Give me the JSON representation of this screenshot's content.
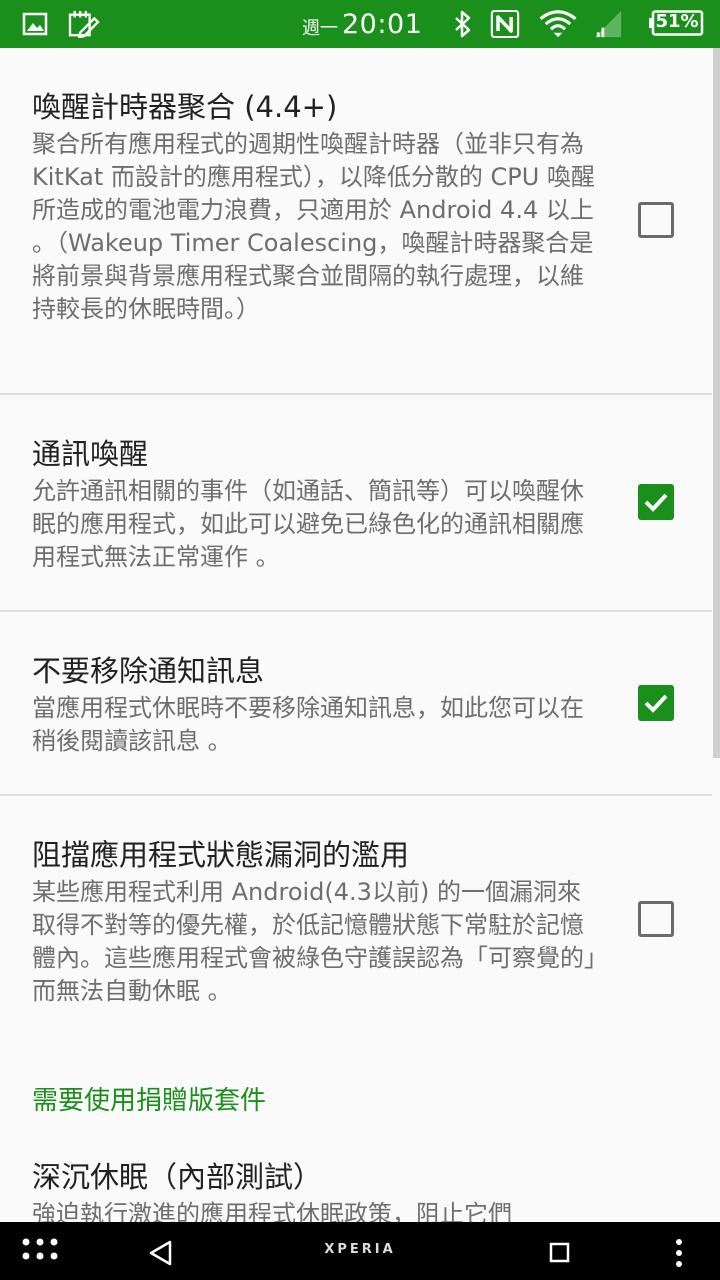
{
  "status_bar": {
    "day_of_week": "週一",
    "time": "20:01",
    "battery": "51%",
    "icons": [
      "image-icon",
      "edit-note-icon",
      "bluetooth-icon",
      "nfc-icon",
      "wifi-icon",
      "signal-icon",
      "battery-icon"
    ]
  },
  "preferences": [
    {
      "title": "喚醒計時器聚合 (4.4+)",
      "summary": "聚合所有應用程式的週期性喚醒計時器（並非只有為 KitKat 而設計的應用程式），以降低分散的 CPU 喚醒所造成的電池電力浪費，只適用於 Android 4.4 以上 。（Wakeup Timer Coalescing，喚醒計時器聚合是將前景與背景應用程式聚合並間隔的執行處理，以維持較長的休眠時間。）",
      "checked": false
    },
    {
      "title": "通訊喚醒",
      "summary": "允許通訊相關的事件（如通話、簡訊等）可以喚醒休眠的應用程式，如此可以避免已綠色化的通訊相關應用程式無法正常運作 。",
      "checked": true
    },
    {
      "title": "不要移除通知訊息",
      "summary": "當應用程式休眠時不要移除通知訊息，如此您可以在稍後閱讀該訊息 。",
      "checked": true
    },
    {
      "title": "阻擋應用程式狀態漏洞的濫用",
      "summary": "某些應用程式利用 Android(4.3以前) 的一個漏洞來取得不對等的優先權，於低記憶體狀態下常駐於記憶體內。這些應用程式會被綠色守護誤認為「可察覺的」而無法自動休眠 。",
      "checked": false
    }
  ],
  "category_header": "需要使用捐贈版套件",
  "deep_hibernation": {
    "title": "深沉休眠（內部測試）",
    "summary": "強迫執行激進的應用程式休眠政策，阻止它們"
  },
  "nav_bar": {
    "brand": "XPERIA",
    "icons": [
      "apps-grid-icon",
      "back-icon",
      "recents-icon",
      "overflow-menu-icon"
    ]
  },
  "colors": {
    "accent": "#1b8f1b",
    "background": "#fafafa",
    "title_text": "#212121",
    "summary_text": "#6e6e6e"
  }
}
